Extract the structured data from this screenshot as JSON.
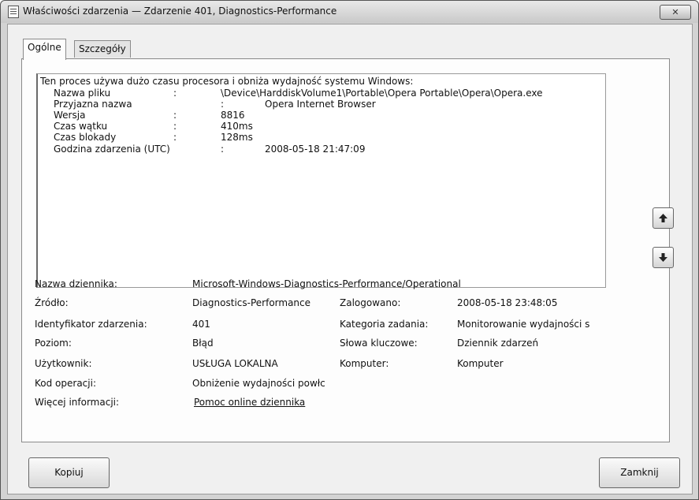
{
  "window": {
    "title": "Właściwości zdarzenia — Zdarzenie 401, Diagnostics-Performance",
    "close_label": "✕"
  },
  "tabs": [
    {
      "label": "Ogólne"
    },
    {
      "label": "Szczegóły"
    }
  ],
  "description": {
    "intro": "Ten proces używa dużo czasu procesora i obniża wydajność systemu Windows:",
    "rows": [
      {
        "label": "Nazwa pliku",
        "sep": ":",
        "value": "\\Device\\HarddiskVolume1\\Portable\\Opera Portable\\Opera\\Opera.exe"
      },
      {
        "label": "Przyjazna nazwa",
        "sep": ":",
        "value": "Opera Internet Browser"
      },
      {
        "label": "Wersja",
        "sep": ":",
        "value": "8816"
      },
      {
        "label": "Czas wątku",
        "sep": ":",
        "value": "410ms"
      },
      {
        "label": "Czas blokady",
        "sep": ":",
        "value": "128ms"
      },
      {
        "label": "Godzina zdarzenia (UTC)",
        "sep": ":",
        "value": "2008-05-18 21:47:09"
      }
    ]
  },
  "nav": {
    "up_icon": "arrow-up-icon",
    "down_icon": "arrow-down-icon"
  },
  "properties": {
    "log_name_label": "Nazwa dziennika:",
    "log_name": "Microsoft-Windows-Diagnostics-Performance/Operational",
    "source_label": "Źródło:",
    "source": "Diagnostics-Performance",
    "logged_label": "Zalogowano:",
    "logged": "2008-05-18 23:48:05",
    "event_id_label": "Identyfikator zdarzenia:",
    "event_id": "401",
    "task_category_label": "Kategoria zadania:",
    "task_category": "Monitorowanie wydajności s",
    "level_label": "Poziom:",
    "level": "Błąd",
    "keywords_label": "Słowa kluczowe:",
    "keywords": "Dziennik zdarzeń",
    "user_label": "Użytkownik:",
    "user": "USŁUGA LOKALNA",
    "computer_label": "Komputer:",
    "computer": "Komputer",
    "opcode_label": "Kod operacji:",
    "opcode": "Obniżenie wydajności powłc",
    "more_info_label": "Więcej informacji:",
    "more_info_link": "Pomoc online dziennika"
  },
  "buttons": {
    "copy": "Kopiuj",
    "close": "Zamknij"
  }
}
